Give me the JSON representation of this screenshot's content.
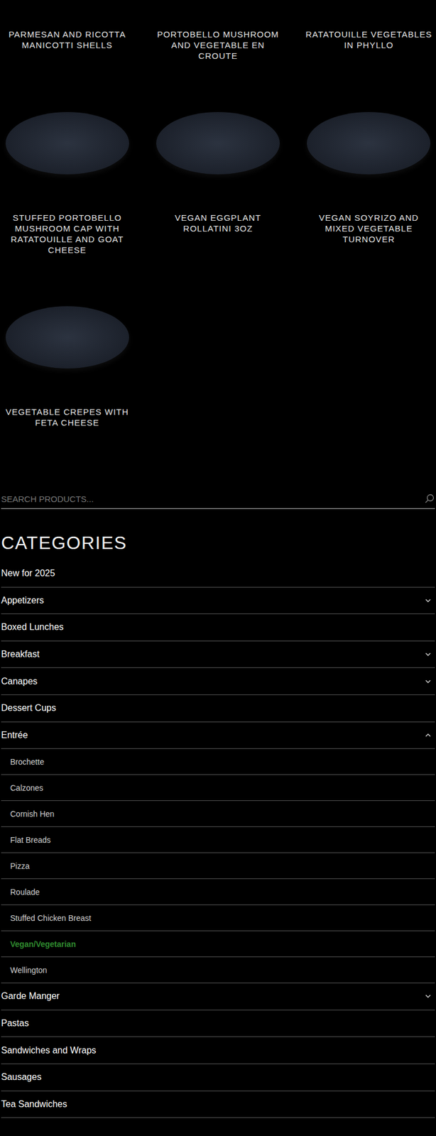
{
  "products": [
    {
      "name": "PARMESAN AND RICOTTA MANICOTTI SHELLS"
    },
    {
      "name": "PORTOBELLO MUSHROOM AND VEGETABLE EN CROUTE"
    },
    {
      "name": "RATATOUILLE VEGETABLES IN PHYLLO"
    },
    {
      "name": "STUFFED PORTOBELLO MUSHROOM CAP WITH RATATOUILLE AND GOAT CHEESE"
    },
    {
      "name": "VEGAN EGGPLANT ROLLATINI 3OZ"
    },
    {
      "name": "VEGAN SOYRIZO AND MIXED VEGETABLE TURNOVER"
    },
    {
      "name": "VEGETABLE CREPES WITH FETA CHEESE"
    }
  ],
  "search": {
    "placeholder": "SEARCH PRODUCTS..."
  },
  "categories": {
    "heading": "CATEGORIES",
    "items": [
      {
        "name": "New for 2025",
        "expandable": false,
        "expanded": false,
        "children": []
      },
      {
        "name": "Appetizers",
        "expandable": true,
        "expanded": false,
        "children": []
      },
      {
        "name": "Boxed Lunches",
        "expandable": false,
        "expanded": false,
        "children": []
      },
      {
        "name": "Breakfast",
        "expandable": true,
        "expanded": false,
        "children": []
      },
      {
        "name": "Canapes",
        "expandable": true,
        "expanded": false,
        "children": []
      },
      {
        "name": "Dessert Cups",
        "expandable": false,
        "expanded": false,
        "children": []
      },
      {
        "name": "Entrée",
        "expandable": true,
        "expanded": true,
        "children": [
          {
            "name": "Brochette",
            "selected": false
          },
          {
            "name": "Calzones",
            "selected": false
          },
          {
            "name": "Cornish Hen",
            "selected": false
          },
          {
            "name": "Flat Breads",
            "selected": false
          },
          {
            "name": "Pizza",
            "selected": false
          },
          {
            "name": "Roulade",
            "selected": false
          },
          {
            "name": "Stuffed Chicken Breast",
            "selected": false
          },
          {
            "name": "Vegan/Vegetarian",
            "selected": true
          },
          {
            "name": "Wellington",
            "selected": false
          }
        ]
      },
      {
        "name": "Garde Manger",
        "expandable": true,
        "expanded": false,
        "children": []
      },
      {
        "name": "Pastas",
        "expandable": false,
        "expanded": false,
        "children": []
      },
      {
        "name": "Sandwiches and Wraps",
        "expandable": false,
        "expanded": false,
        "children": []
      },
      {
        "name": "Sausages",
        "expandable": false,
        "expanded": false,
        "children": []
      },
      {
        "name": "Tea Sandwiches",
        "expandable": false,
        "expanded": false,
        "children": []
      }
    ]
  }
}
